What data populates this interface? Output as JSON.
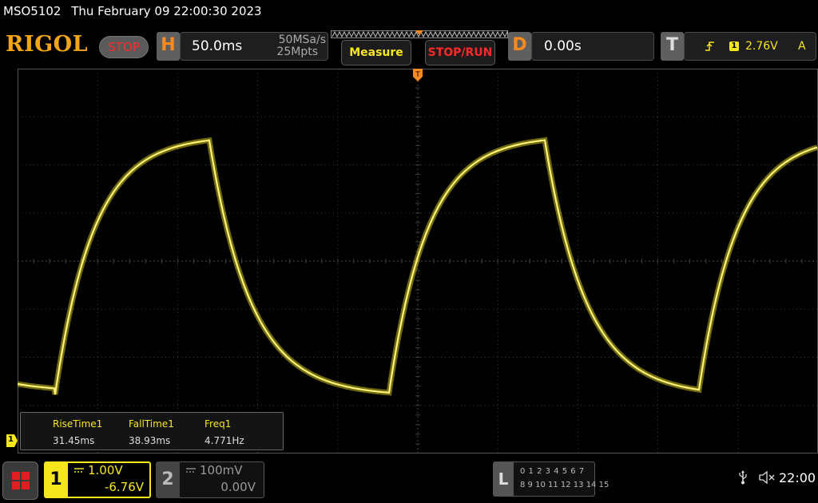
{
  "title": {
    "model": "MSO5102",
    "datetime": "Thu February 09 22:00:30 2023"
  },
  "toolbar": {
    "logo": "RIGOL",
    "run_state": "STOP",
    "horizontal": {
      "tab": "H",
      "timebase": "50.0ms",
      "sample_rate": "50MSa/s",
      "memory_depth": "25Mpts"
    },
    "measure_label": "Measure",
    "stop_run_label": "STOP/RUN",
    "delay": {
      "tab": "D",
      "value": "0.00s"
    },
    "trigger": {
      "tab": "T",
      "edge_icon": "rising-edge-icon",
      "source": "1",
      "level": "2.76V",
      "mode": "A"
    }
  },
  "display": {
    "trace_color": "#f5e61e",
    "grid_color": "#3c3c3c",
    "trigger_marker_color": "#ff8a1e",
    "channel1_ground_marker": "1"
  },
  "measurements": [
    {
      "name": "RiseTime1",
      "value": "31.45ms"
    },
    {
      "name": "FallTime1",
      "value": "38.93ms"
    },
    {
      "name": "Freq1",
      "value": "4.771Hz"
    }
  ],
  "channels": [
    {
      "number": "1",
      "scale": "1.00V",
      "offset": "-6.76V",
      "active": true
    },
    {
      "number": "2",
      "scale": "100mV",
      "offset": "0.00V",
      "active": false
    }
  ],
  "logic": {
    "tab": "L",
    "row1": "0 1 2 3   4 5 6 7",
    "row2": "8 9 10 11  12 13 14 15"
  },
  "status": {
    "usb_icon": "usb-icon",
    "sound_icon": "sound-muted-icon",
    "clock": "22:00"
  }
}
